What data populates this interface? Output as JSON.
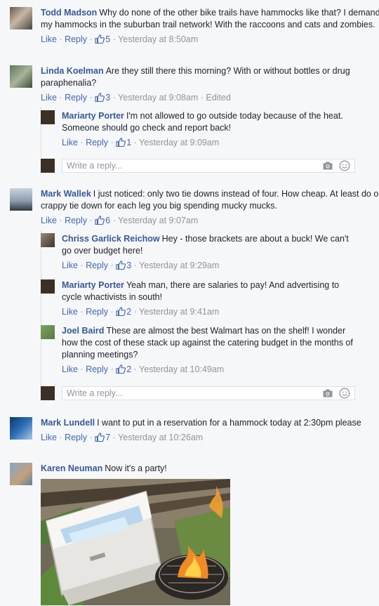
{
  "actions": {
    "like": "Like",
    "reply": "Reply",
    "separator": "·"
  },
  "write_reply_placeholder": "Write a reply...",
  "comments": [
    {
      "author": "Todd Madson",
      "text": "Why do none of the other bike trails have hammocks like that? I demand my hammocks in the suburban trail network! With the raccoons and cats and zombies.",
      "likes": "5",
      "time": "Yesterday at 8:50am"
    },
    {
      "author": "Linda Koelman",
      "text": "Are they still there this morning? With or without bottles or drug paraphenalia?",
      "likes": "3",
      "time": "Yesterday at 9:08am",
      "edited": "Edited",
      "replies": [
        {
          "author": "Mariarty Porter",
          "text": "I'm not allowed to go outside today because of the heat. Someone should go check and report back!",
          "likes": "1",
          "time": "Yesterday at 9:09am"
        }
      ]
    },
    {
      "author": "Mark Wallek",
      "text": "I just noticed: only two tie downs instead of four. How cheap. At least do one crappy tie down for each leg you big spending mucky mucks.",
      "likes": "6",
      "time": "Yesterday at 9:07am",
      "replies": [
        {
          "author": "Chriss Garlick Reichow",
          "text": "Hey - those brackets are about a buck! We can't go over budget here!",
          "likes": "3",
          "time": "Yesterday at 9:29am"
        },
        {
          "author": "Mariarty Porter",
          "text": "Yeah man, there are salaries to pay! And advertising to cycle whactivists in south!",
          "likes": "2",
          "time": "Yesterday at 9:41am"
        },
        {
          "author": "Joel Baird",
          "text": "These are almost the best Walmart has on the shelf! I wonder how the cost of these stack up against the catering budget in the months of planning meetings?",
          "likes": "2",
          "time": "Yesterday at 10:49am"
        }
      ]
    },
    {
      "author": "Mark Lundell",
      "text": "I want to put in a reservation for a hammock today at 2:30pm please",
      "likes": "7",
      "time": "Yesterday at 10:26am"
    },
    {
      "author": "Karen Neuman",
      "text": "Now it's a party!"
    }
  ],
  "colors": {
    "link": "#365899",
    "meta": "#90949c",
    "background": "#f6f7f9"
  }
}
